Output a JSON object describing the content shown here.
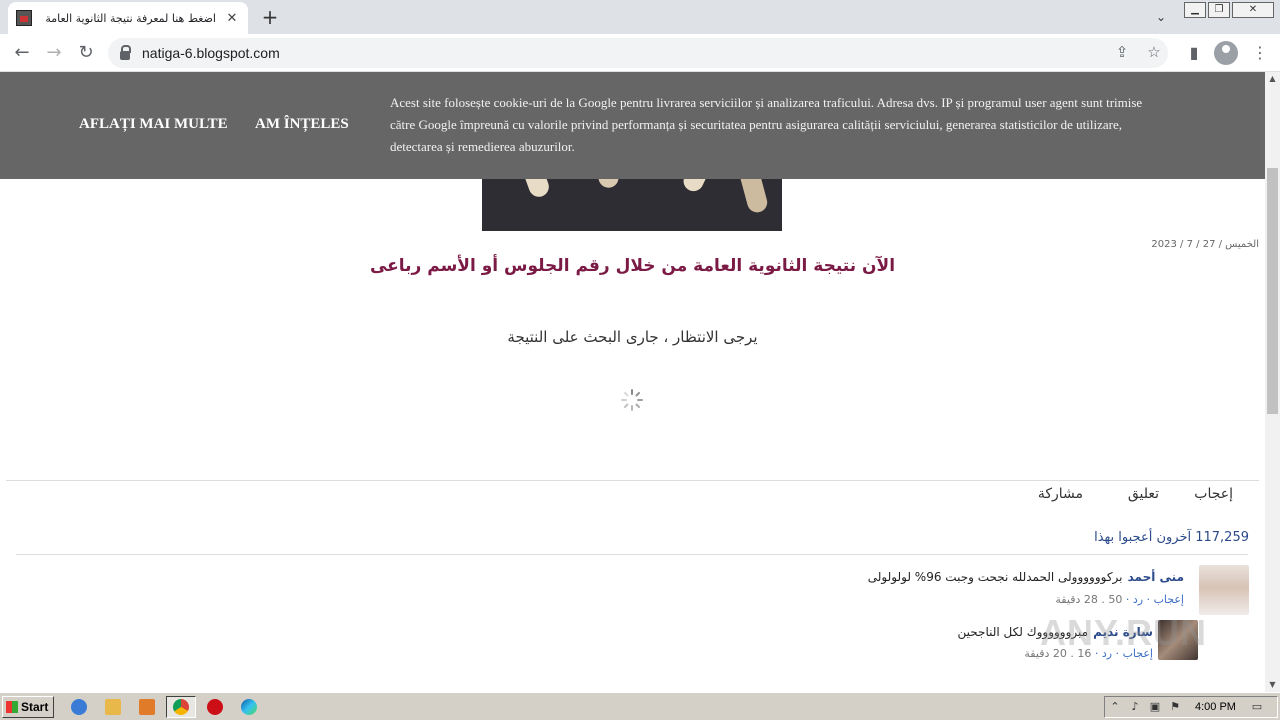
{
  "browser": {
    "tab_title": "اضغط هنا لمعرفة نتيجة الثانوية العامة",
    "url": "natiga-6.blogspot.com"
  },
  "cookie_banner": {
    "learn_more": "AFLAȚI MAI MULTE",
    "accept": "AM ÎNȚELES",
    "text": "Acest site folosește cookie-uri de la Google pentru livrarea serviciilor și analizarea traficului. Adresa dvs. IP și programul user agent sunt trimise către Google împreună cu valorile privind performanța și securitatea pentru asigurarea calității serviciului, generarea statisticilor de utilizare, detectarea și remedierea abuzurilor."
  },
  "post": {
    "date": "الخميس / 27 / 7 / 2023",
    "headline": "الآن نتيجة الثانوية العامة من خلال رقم الجلوس أو الأسم رباعى",
    "waiting": "يرجى الانتظار ، جارى البحث على النتيجة"
  },
  "actions": {
    "like": "إعجاب",
    "comment": "تعليق",
    "share": "مشاركة"
  },
  "likes_summary": "117,259 آخرون أعجبوا بهذا",
  "comments": [
    {
      "name": "منى أحمد",
      "text": "بركوووووولى الحمدلله نجحت وجبت 96% لولولولى",
      "like": "إعجاب",
      "reply": "رد",
      "count": "50",
      "time": "28 دقيقة"
    },
    {
      "name": "سارة نديم",
      "text": "مبرووووووك لكل الناجحين",
      "like": "إعجاب",
      "reply": "رد",
      "count": "16",
      "time": "20 دقيقة"
    }
  ],
  "watermark": "ANY.RUN",
  "taskbar": {
    "start": "Start",
    "clock": "4:00 PM"
  },
  "colors": {
    "headline": "#7a1a45",
    "link": "#2a4a8b",
    "banner": "#666666"
  }
}
